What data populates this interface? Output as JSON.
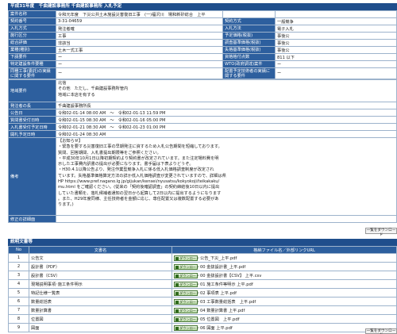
{
  "header": {
    "title": "平成31年度　千曲建設事務所 千曲建設事務所 入札予定"
  },
  "info_rows": [
    {
      "l1": "案件名称",
      "v1": "令和元年度　下災公共土木施設災害復旧工事　(一)福沢川　場和新砂総合　上平",
      "l2": "",
      "v2": ""
    },
    {
      "l1": "契約番号",
      "v1": "3-31-04659",
      "l2": "契約方式",
      "v2": "一般競争"
    },
    {
      "l1": "入札方式",
      "v1": "発注者確",
      "l2": "入札方法",
      "v2": "電子入札"
    },
    {
      "l1": "施行区分",
      "v1": "工事",
      "l2": "予定価格(税抜)",
      "v2": "事後公"
    },
    {
      "l1": "総合評価",
      "v1": "非該当",
      "l2": "調査基準価格(税抜)",
      "v2": "事後公"
    },
    {
      "l1": "業種(種別)",
      "v1": "土木一式工事",
      "l2": "失格基準価格(税抜)",
      "v2": "事後公"
    },
    {
      "l1": "下請要件",
      "v1": "ー",
      "l2": "資格格付点数",
      "v2": "811 以下"
    },
    {
      "l1": "特定建設条件要種",
      "v1": "ー",
      "l2": "WTO(政府調達)案件",
      "v2": "ー"
    },
    {
      "l1": "同種工事(委託)の実績に関する要件",
      "v1": "ー",
      "l2": "配置予定技術者の実績に関する要件",
      "v2": "ー"
    }
  ],
  "region": {
    "label": "地域要件",
    "lines": [
      "北信",
      "その他　ただし、千曲建設事務所管内",
      "地域に本店を有する"
    ]
  },
  "detail_rows": [
    {
      "label": "発注者の長",
      "value": "千曲建設事務所長"
    },
    {
      "label": "公告日",
      "value": "令和02-01-14 08:00 AM　～　令和02-01-13 11:59 PM"
    },
    {
      "label": "質問書受付日時",
      "value": "令和02-01-15 08:30 AM　～　令和02-01-16 05:00 PM"
    },
    {
      "label": "入札書受付予定日時",
      "value": "令和02-01-21 08:30 AM　～　令和02-01-23 01:00 PM"
    },
    {
      "label": "開札予定日時",
      "value": "令和02-01-24 08:30 AM"
    }
  ],
  "remarks": {
    "label": "備考",
    "lines": [
      "【お知らせ】",
      "・緊急を要する災害復旧工事の早期発注に資するため入札公告期間を短縮しております。",
      "質問、回答期間、入札書提出期限等をご参照ください。",
      "・平成30年10月1日以降初期契約より契約書が改定されています。また注定場料費を明",
      "示した工事費内訳書の提出が必要になります。書手届は下表よりどうぞ。",
      "・H30.4.1以降公告より、発注作業型競争入札に係る低入札価格調査制度が改定され",
      "ています。失格基準価格算定方法の詳か低入札価格調査が変更されていますので、詳細は県",
      "HP https://www.pref.nagano.lg.jp/gijukan/kensei/nyusatsu/kokyokoji/teikakaku/",
      "mu.html をご確認ください。(従来の「契約後確認調査」の契約締結後10日以内に提出",
      "していた書類を、落札候補者通知の翌日から起算して2日以内に提出するようになります",
      "。また、H29年度同様、主任技術者を金額に応じ、専任配置又は複数配置する必要があ",
      "ります。)"
    ]
  },
  "correction": {
    "label": "修正の詳細面",
    "value": ""
  },
  "list_button": "一覧をダウンロード",
  "docs_section": {
    "title": "説明文書等",
    "col_no": "No",
    "col_name": "文書名",
    "col_file": "格納ファイル名／外部リンクURL",
    "download_label": "ダウンロード",
    "rows": [
      {
        "no": "1",
        "name": "公告文",
        "file": "公告_下災_上平.pdf"
      },
      {
        "no": "2",
        "name": "設計書（PDF）",
        "file": "00 金抜設計書_上平.pdf"
      },
      {
        "no": "3",
        "name": "設計書（CSV）",
        "file": "00 金抜設計書【CSV】 上平.csv"
      },
      {
        "no": "4",
        "name": "現場説明事項･施工条件明示",
        "file": "01 施工条件等明示 上平.pdf"
      },
      {
        "no": "5",
        "name": "特記仕様一覧表",
        "file": "02 事項表 上平.pdf"
      },
      {
        "no": "6",
        "name": "数量総括表",
        "file": "03 工事数量総括表　上平.pdf"
      },
      {
        "no": "7",
        "name": "数量計算書",
        "file": "04 数量計算書 上平.pdf"
      },
      {
        "no": "8",
        "name": "位置図",
        "file": "05 位置図　上平.pdf"
      },
      {
        "no": "9",
        "name": "図面",
        "file": "06 図面 上平.pdf"
      }
    ]
  }
}
